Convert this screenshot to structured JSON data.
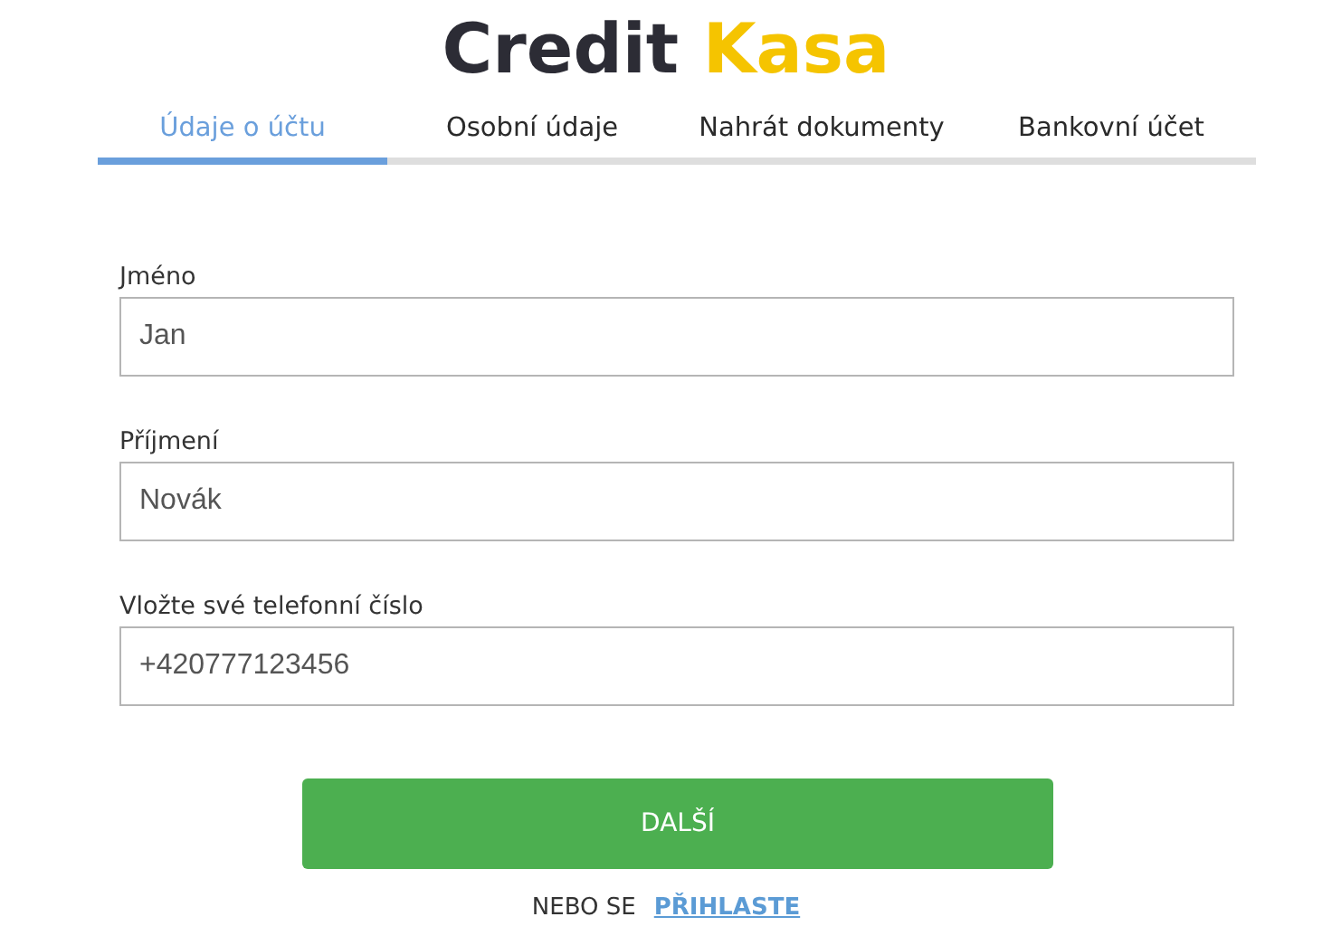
{
  "logo": {
    "first": "Credit",
    "second": "Kasa"
  },
  "tabs": [
    {
      "label": "Údaje o účtu",
      "selected": true
    },
    {
      "label": "Osobní údaje",
      "selected": false
    },
    {
      "label": "Nahrát dokumenty",
      "selected": false
    },
    {
      "label": "Bankovní účet",
      "selected": false
    }
  ],
  "fields": [
    {
      "label": "Jméno",
      "value": "Jan"
    },
    {
      "label": "Příjmení",
      "value": "Novák"
    },
    {
      "label": "Vložte své telefonní číslo",
      "value": "+420777123456"
    }
  ],
  "next_button": "DALŠÍ",
  "login": {
    "text": "NEBO SE",
    "link": "PŘIHLASTE"
  }
}
